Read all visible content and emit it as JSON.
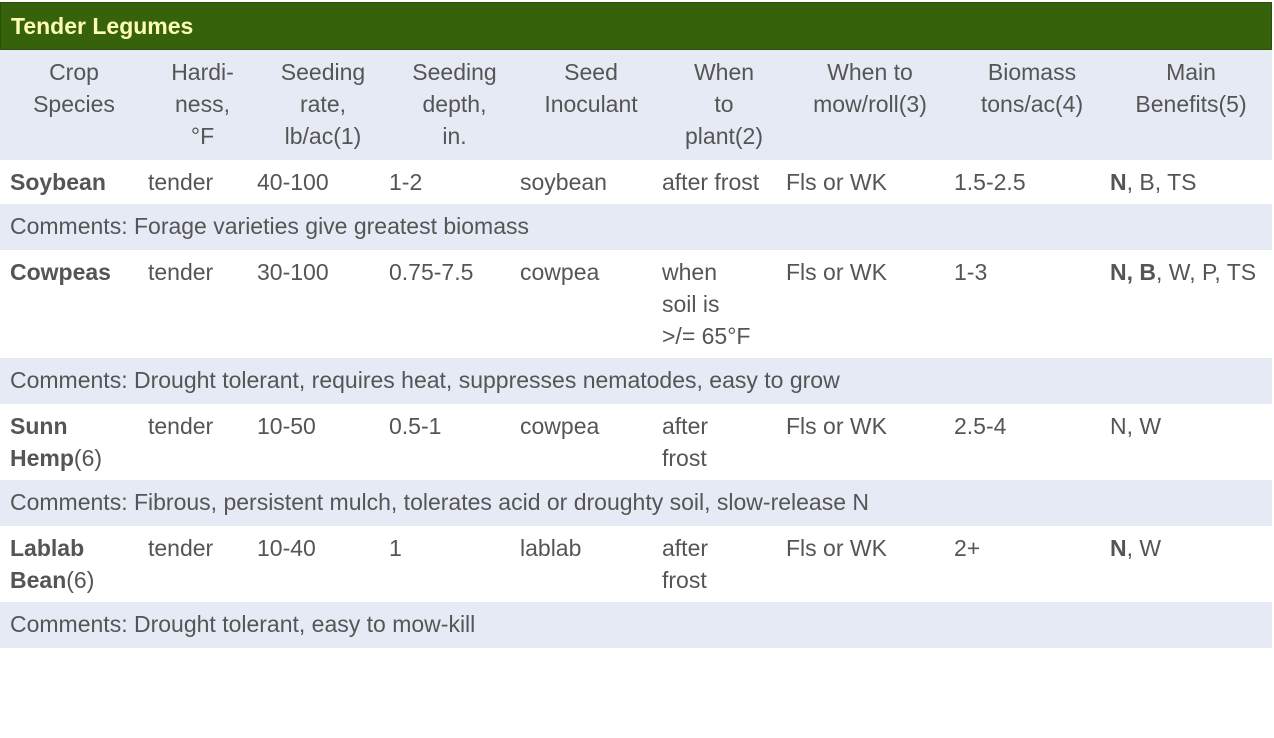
{
  "section_title": "Tender Legumes",
  "columns": [
    {
      "line1": "Crop",
      "line2": "Species",
      "line3": ""
    },
    {
      "line1": "Hardi-",
      "line2": "ness,",
      "line3": "°F"
    },
    {
      "line1": "Seeding",
      "line2": "rate,",
      "line3": "lb/ac(1)"
    },
    {
      "line1": "Seeding",
      "line2": "depth,",
      "line3": "in."
    },
    {
      "line1": "Seed",
      "line2": "Inoculant",
      "line3": ""
    },
    {
      "line1": "When",
      "line2": "to",
      "line3": "plant(2)"
    },
    {
      "line1": "When to",
      "line2": "mow/roll(3)",
      "line3": ""
    },
    {
      "line1": "Biomass",
      "line2": "tons/ac(4)",
      "line3": ""
    },
    {
      "line1": "Main",
      "line2": "Benefits(5)",
      "line3": ""
    }
  ],
  "rows": [
    {
      "crop": "Soybean",
      "crop_note": "",
      "hardiness": "tender",
      "rate": "40-100",
      "depth": "1-2",
      "inoculant": "soybean",
      "plant": "after frost",
      "mow": "Fls or WK",
      "biomass": "1.5-2.5",
      "benefits_bold": "N",
      "benefits_rest": ", B, TS",
      "comment": "Comments: Forage varieties give greatest biomass"
    },
    {
      "crop": "Cowpeas",
      "crop_note": "",
      "hardiness": "tender",
      "rate": "30-100",
      "depth": "0.75-7.5",
      "inoculant": "cowpea",
      "plant": "when soil is >/= 65°F",
      "mow": "Fls or WK",
      "biomass": "1-3",
      "benefits_bold": "N, B",
      "benefits_rest": ", W, P, TS",
      "comment": "Comments: Drought tolerant, requires heat, suppresses nematodes, easy to grow"
    },
    {
      "crop": "Sunn Hemp",
      "crop_note": "(6)",
      "hardiness": "tender",
      "rate": "10-50",
      "depth": "0.5-1",
      "inoculant": "cowpea",
      "plant": "after frost",
      "mow": "Fls or WK",
      "biomass": "2.5-4",
      "benefits_bold": "",
      "benefits_rest": "N, W",
      "comment": "Comments: Fibrous, persistent mulch, tolerates acid or droughty soil, slow-release N"
    },
    {
      "crop": "Lablab Bean",
      "crop_note": "(6)",
      "hardiness": "tender",
      "rate": "10-40",
      "depth": "1",
      "inoculant": "lablab",
      "plant": "after frost",
      "mow": "Fls or WK",
      "biomass": "2+",
      "benefits_bold": "N",
      "benefits_rest": ", W",
      "comment": "Comments: Drought tolerant, easy to mow-kill"
    }
  ]
}
